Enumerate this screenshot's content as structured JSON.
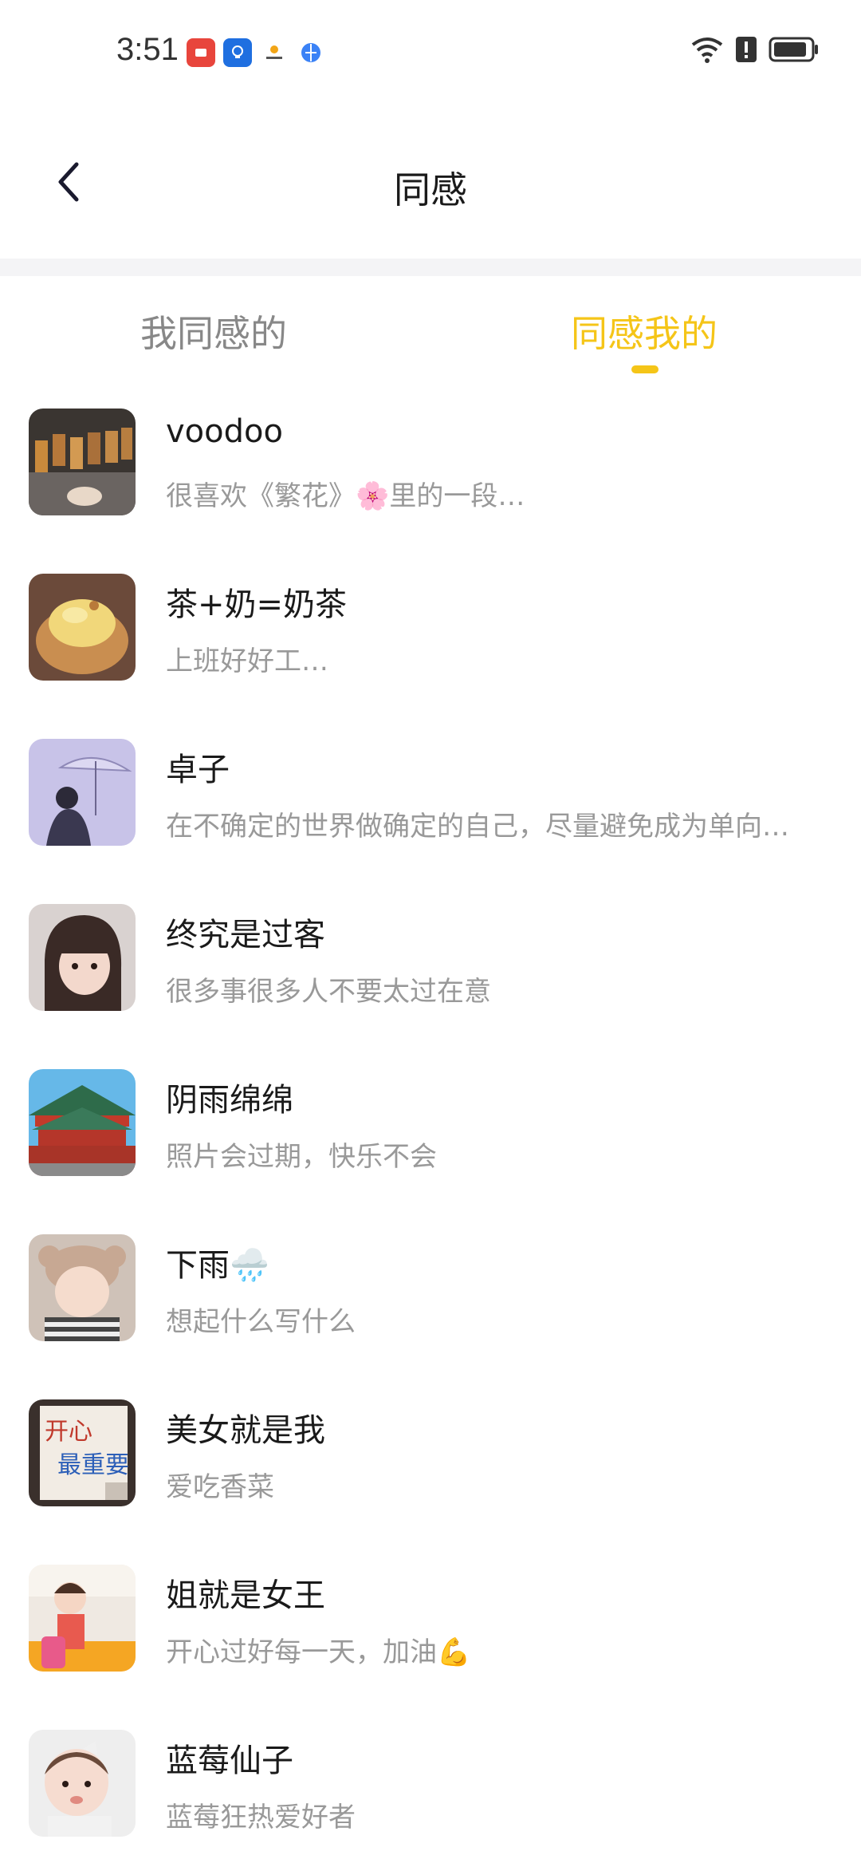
{
  "status_bar": {
    "time": "3:51",
    "apps": [
      {
        "icon": "huawei-app-icon",
        "color": "#e8453c"
      },
      {
        "icon": "bulb-app-icon",
        "color": "#1f6fe0"
      },
      {
        "icon": "sun-app-icon",
        "color": "#f2a516"
      },
      {
        "icon": "globe-app-icon",
        "color": "#3b82f6"
      }
    ],
    "icons": [
      "wifi-icon",
      "alert-icon",
      "battery-icon"
    ]
  },
  "header": {
    "title": "同感",
    "back_icon": "chevron-left-icon"
  },
  "tabs": [
    {
      "label": "我同感的",
      "active": false
    },
    {
      "label": "同感我的",
      "active": true
    }
  ],
  "accent_color": "#F5C518",
  "items": [
    {
      "name": "voodoo",
      "desc": "很喜欢《繁花》🌸里的一段…",
      "avatar": "bubble-tea-photo"
    },
    {
      "name": "茶+奶=奶茶",
      "desc": "上班好好工…",
      "avatar": "egg-tart-photo"
    },
    {
      "name": "卓子",
      "desc": "在不确定的世界做确定的自己，尽量避免成为单向…",
      "avatar": "umbrella-girl-photo"
    },
    {
      "name": "终究是过客",
      "desc": "很多事很多人不要太过在意",
      "avatar": "girl-portrait-photo"
    },
    {
      "name": "阴雨绵绵",
      "desc": "照片会过期，快乐不会",
      "avatar": "palace-photo"
    },
    {
      "name": "下雨🌧️",
      "desc": "想起什么写什么",
      "avatar": "baby-hat-photo"
    },
    {
      "name": "美女就是我",
      "desc": "爱吃香菜",
      "avatar": "calligraphy-card-photo"
    },
    {
      "name": "姐就是女王",
      "desc": "开心过好每一天，加油💪",
      "avatar": "toddler-photo"
    },
    {
      "name": "蓝莓仙子",
      "desc": "蓝莓狂热爱好者",
      "avatar": "baby-bow-photo"
    }
  ]
}
